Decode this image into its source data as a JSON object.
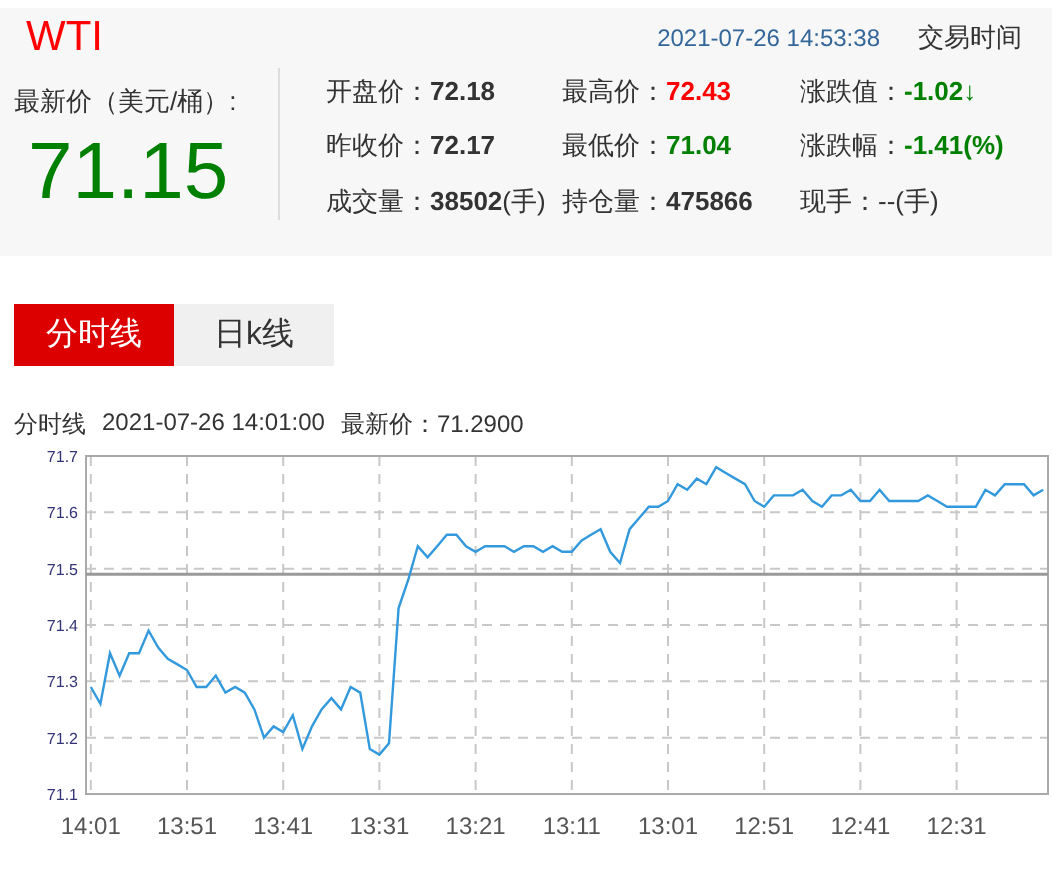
{
  "header": {
    "symbol": "WTI",
    "datetime": "2021-07-26 14:53:38",
    "link": "交易时间",
    "price_label": "最新价（美元/桶）:",
    "price": "71.15",
    "stats": [
      {
        "label": "开盘价：",
        "value": "**72.18**",
        "color": "#333333"
      },
      {
        "label": "最高价：",
        "value": "**72.43**",
        "color": "#ff0000"
      },
      {
        "label": "涨跌值：",
        "value": "**-1.02↓**",
        "color": "#008000"
      },
      {
        "label": "昨收价：",
        "value": "**72.17**",
        "color": "#333333"
      },
      {
        "label": "最低价：",
        "value": "**71.04**",
        "color": "#008000"
      },
      {
        "label": "涨跌幅：",
        "value": "**-1.41(%)**",
        "color": "#008000"
      },
      {
        "label": "成交量：",
        "value": "**38502**(手)",
        "color": "#333333"
      },
      {
        "label": "持仓量：",
        "value": "**475866**",
        "color": "#333333"
      },
      {
        "label": "现手：",
        "value": "--(手)",
        "color": "#333333"
      }
    ]
  },
  "tabs": [
    {
      "label": "分时线",
      "selected": true
    },
    {
      "label": "日k线",
      "selected": false
    }
  ],
  "chart_info": {
    "title": "分时线",
    "time": "2021-07-26 14:01:00",
    "price": "最新价：71.2900"
  },
  "chart_data": {
    "type": "line",
    "ylim": [
      71.1,
      71.7
    ],
    "yticks": [
      71.1,
      71.2,
      71.3,
      71.4,
      71.5,
      71.6,
      71.7
    ],
    "grid": true,
    "ref_lines": [
      {
        "axis": "y",
        "value": 71.49,
        "color": "#999999"
      }
    ],
    "categories": [
      "14:01",
      null,
      null,
      null,
      null,
      null,
      null,
      null,
      null,
      null,
      "13:51",
      null,
      null,
      null,
      null,
      null,
      null,
      null,
      null,
      null,
      "13:41",
      null,
      null,
      null,
      null,
      null,
      null,
      null,
      null,
      null,
      "13:31",
      null,
      null,
      null,
      null,
      null,
      null,
      null,
      null,
      null,
      "13:21",
      null,
      null,
      null,
      null,
      null,
      null,
      null,
      null,
      null,
      "13:11",
      null,
      null,
      null,
      null,
      null,
      null,
      null,
      null,
      null,
      "13:01",
      null,
      null,
      null,
      null,
      null,
      null,
      null,
      null,
      null,
      "12:51",
      null,
      null,
      null,
      null,
      null,
      null,
      null,
      null,
      null,
      "12:41",
      null,
      null,
      null,
      null,
      null,
      null,
      null,
      null,
      null,
      "12:31",
      null,
      null,
      null,
      null,
      null,
      null,
      null,
      null,
      null
    ],
    "series": [
      {
        "color": "#3399dd",
        "values": [
          71.29,
          71.26,
          71.35,
          71.31,
          71.35,
          71.35,
          71.39,
          71.36,
          71.34,
          71.33,
          71.32,
          71.29,
          71.29,
          71.31,
          71.28,
          71.29,
          71.28,
          71.25,
          71.2,
          71.22,
          71.21,
          71.24,
          71.18,
          71.22,
          71.25,
          71.27,
          71.25,
          71.29,
          71.28,
          71.18,
          71.17,
          71.19,
          71.43,
          71.48,
          71.54,
          71.52,
          71.54,
          71.56,
          71.56,
          71.54,
          71.53,
          71.54,
          71.54,
          71.54,
          71.53,
          71.54,
          71.54,
          71.53,
          71.54,
          71.53,
          71.53,
          71.55,
          71.56,
          71.57,
          71.53,
          71.51,
          71.57,
          71.59,
          71.61,
          71.61,
          71.62,
          71.65,
          71.64,
          71.66,
          71.65,
          71.68,
          71.67,
          71.66,
          71.65,
          71.62,
          71.61,
          71.63,
          71.63,
          71.63,
          71.64,
          71.62,
          71.61,
          71.63,
          71.63,
          71.64,
          71.62,
          71.62,
          71.64,
          71.62,
          71.62,
          71.62,
          71.62,
          71.63,
          71.62,
          71.61,
          71.61,
          71.61,
          71.61,
          71.64,
          71.63,
          71.65,
          71.65,
          71.65,
          71.63,
          71.64
        ]
      }
    ]
  }
}
